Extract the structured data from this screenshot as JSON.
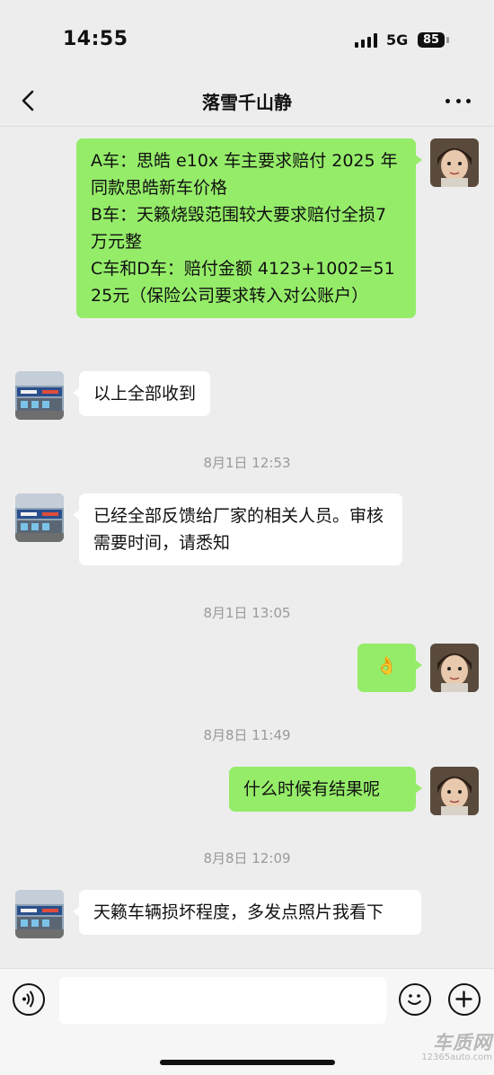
{
  "status_bar": {
    "time": "14:55",
    "network": "5G",
    "battery": "85"
  },
  "nav": {
    "title": "落雪千山静"
  },
  "messages": [
    {
      "type": "out",
      "text": "A车：思皓 e10x 车主要求赔付 2025 年同款思皓新车价格\nB车：天籁烧毁范围较大要求赔付全损7万元整\nC车和D车：赔付金额 4123+1002=5125元（保险公司要求转入对公账户）"
    },
    {
      "type": "in",
      "text": "以上全部收到"
    },
    {
      "type": "time",
      "text": "8月1日 12:53"
    },
    {
      "type": "in",
      "text": "已经全部反馈给厂家的相关人员。审核需要时间，请悉知"
    },
    {
      "type": "time",
      "text": "8月1日 13:05"
    },
    {
      "type": "out",
      "text": "👌"
    },
    {
      "type": "time",
      "text": "8月8日 11:49"
    },
    {
      "type": "out",
      "text": "什么时候有结果呢"
    },
    {
      "type": "time",
      "text": "8月8日 12:09"
    },
    {
      "type": "in",
      "text": "天籁车辆损坏程度，多发点照片我看下"
    }
  ],
  "input": {
    "value": ""
  },
  "watermark": {
    "name": "车质网",
    "url": "12365auto.com"
  },
  "colors": {
    "outgoing_bubble": "#95ec69",
    "incoming_bubble": "#ffffff",
    "background": "#ededed"
  }
}
